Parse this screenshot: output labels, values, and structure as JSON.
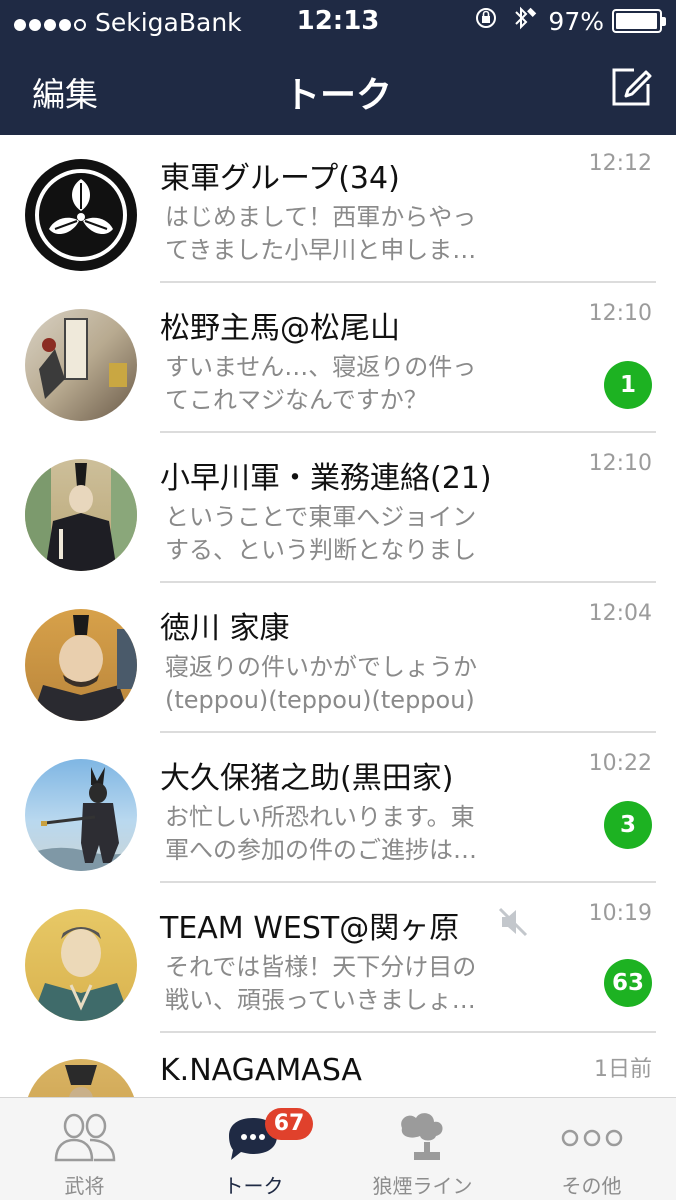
{
  "status_bar": {
    "carrier": "SekigaBank",
    "time": "12:13",
    "battery": "97%",
    "battery_level": 0.97
  },
  "nav": {
    "edit_label": "編集",
    "title": "トーク"
  },
  "chats": [
    {
      "name": "東軍グループ(34)",
      "time": "12:12",
      "line1": "はじめまして！西軍からやっ",
      "line2": "てきました小早川と申しま…",
      "badge": ""
    },
    {
      "name": "松野主馬@松尾山",
      "time": "12:10",
      "line1": "すいません…、寝返りの件っ",
      "line2": "てこれマジなんですか？",
      "badge": "1"
    },
    {
      "name": "小早川軍・業務連絡(21)",
      "time": "12:10",
      "line1": "ということで東軍へジョイン",
      "line2": "する、という判断となりまし",
      "badge": ""
    },
    {
      "name": "徳川 家康",
      "time": "12:04",
      "line1": "寝返りの件いかがでしょうか",
      "line2": "(teppou)(teppou)(teppou)",
      "badge": ""
    },
    {
      "name": "大久保猪之助(黒田家)",
      "time": "10:22",
      "line1": "お忙しい所恐れいります。東",
      "line2": "軍への参加の件のご進捗は…",
      "badge": "3"
    },
    {
      "name": "TEAM WEST@関ヶ原",
      "time": "10:19",
      "line1": "それでは皆様！天下分け目の",
      "line2": "戦い、頑張っていきましょ…",
      "badge": "63",
      "muted": true
    },
    {
      "name": "K.NAGAMASA",
      "time": "1日前",
      "line1": "",
      "line2": "",
      "badge": ""
    }
  ],
  "tabbar": {
    "tabs": [
      {
        "label": "武将",
        "icon": "friends-icon"
      },
      {
        "label": "トーク",
        "icon": "chat-bubble-icon",
        "badge": "67"
      },
      {
        "label": "狼煙ライン",
        "icon": "smoke-signal-icon"
      },
      {
        "label": "その他",
        "icon": "more-icon"
      }
    ]
  },
  "colors": {
    "header_bg": "#1f2a44",
    "badge_green": "#1db222",
    "badge_red": "#e0412c"
  }
}
